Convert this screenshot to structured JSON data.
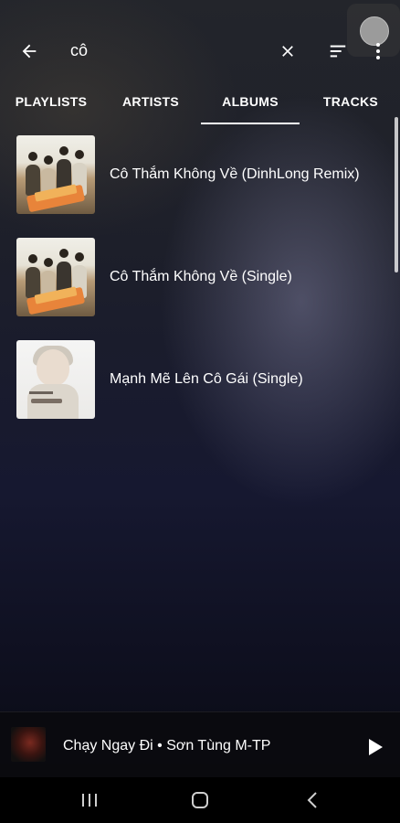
{
  "search": {
    "query": "cô"
  },
  "tabs": [
    {
      "label": "PLAYLISTS"
    },
    {
      "label": "ARTISTS"
    },
    {
      "label": "ALBUMS",
      "selected": true
    },
    {
      "label": "TRACKS"
    }
  ],
  "albums": [
    {
      "title": "Cô Thắm Không Về (DinhLong Remix)"
    },
    {
      "title": "Cô Thắm Không Về (Single)"
    },
    {
      "title": "Mạnh Mẽ Lên Cô Gái (Single)"
    }
  ],
  "now_playing": {
    "text": "Chạy Ngay Đi • Sơn Tùng M-TP"
  },
  "colors": {
    "accent": "#ffffff",
    "background_top": "#23252b",
    "background_bottom": "#06060c"
  },
  "icons": {
    "back": "arrow-left-icon",
    "clear": "close-icon",
    "sort": "sort-icon",
    "more": "more-vert-icon",
    "play": "play-icon",
    "nav_recents": "recents-icon",
    "nav_home": "home-icon",
    "nav_back": "nav-back-icon"
  }
}
